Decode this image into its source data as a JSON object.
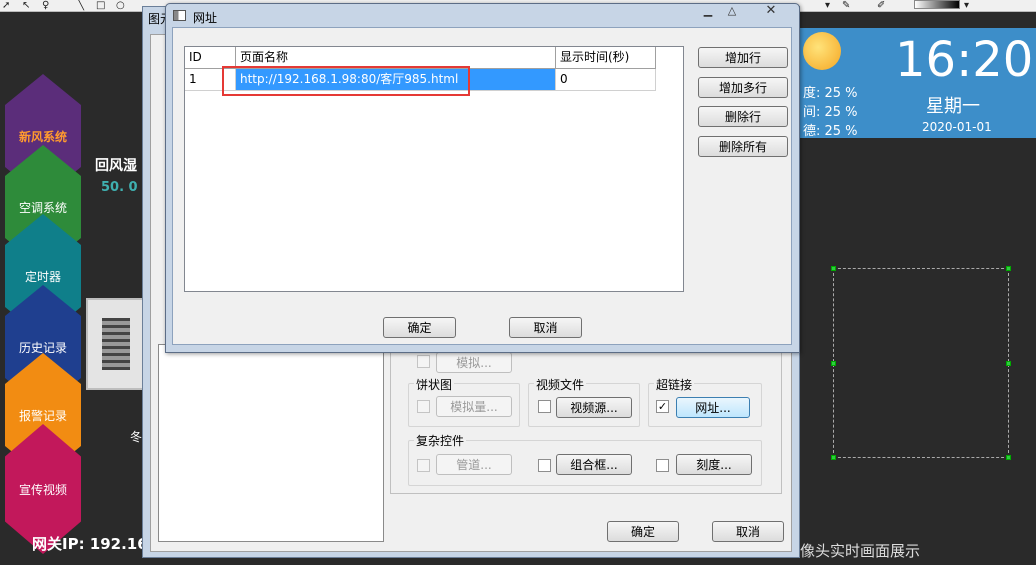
{
  "toolbar": {
    "icons": [
      "pointer-icon",
      "select-icon",
      "tooltip-icon",
      "line-icon",
      "rect-icon",
      "ellipse-icon",
      "fill-icon",
      "pen-color-icon",
      "gradient-bar"
    ]
  },
  "nav": {
    "items": [
      {
        "label": "新风系统",
        "color": "#5b2d7a",
        "text_color": "#ff9a2e"
      },
      {
        "label": "空调系统",
        "color": "#2e8b3a",
        "text_color": "#ffffff"
      },
      {
        "label": "定时器",
        "color": "#0f7f8a",
        "text_color": "#ffffff"
      },
      {
        "label": "历史记录",
        "color": "#1f3f8f",
        "text_color": "#ffffff"
      },
      {
        "label": "报警记录",
        "color": "#f28c12",
        "text_color": "#ffffff"
      },
      {
        "label": "宣传视频",
        "color": "#c2185b",
        "text_color": "#ffffff"
      }
    ]
  },
  "left": {
    "return_air_label": "回风湿",
    "return_air_value": "50. 0",
    "winter_text": "冬",
    "gateway": "网关IP: 192.16"
  },
  "weather": {
    "rows": [
      "度: 25 %",
      "间: 25 %",
      "德: 25 %"
    ],
    "time": "16:20",
    "weekday": "星期一",
    "date": "2020-01-01",
    "bg_color": "#3d8ec9"
  },
  "camera_text": "像头实时画面展示",
  "prop_dialog": {
    "title": "图元",
    "groups": {
      "pie": {
        "label": "饼状图",
        "button": "模拟量..."
      },
      "video": {
        "label": "视频文件",
        "button": "视频源..."
      },
      "link": {
        "label": "超链接",
        "button": "网址...",
        "checked": "✓"
      },
      "complex": {
        "label": "复杂控件"
      },
      "pipe": {
        "button": "管道..."
      },
      "combo": {
        "button": "组合框..."
      },
      "scale": {
        "button": "刻度..."
      },
      "analog_top": {
        "button": "模拟..."
      }
    },
    "ok": "确定",
    "cancel": "取消"
  },
  "url_dialog": {
    "title": "网址",
    "columns": [
      "ID",
      "页面名称",
      "显示时间(秒)"
    ],
    "rows": [
      {
        "id": "1",
        "url": "http://192.168.1.98:80/客厅985.html",
        "time": "0"
      }
    ],
    "buttons": {
      "add_row": "增加行",
      "add_rows": "增加多行",
      "delete_row": "删除行",
      "delete_all": "删除所有"
    },
    "ok": "确定",
    "cancel": "取消",
    "highlight_color": "#e53935"
  }
}
